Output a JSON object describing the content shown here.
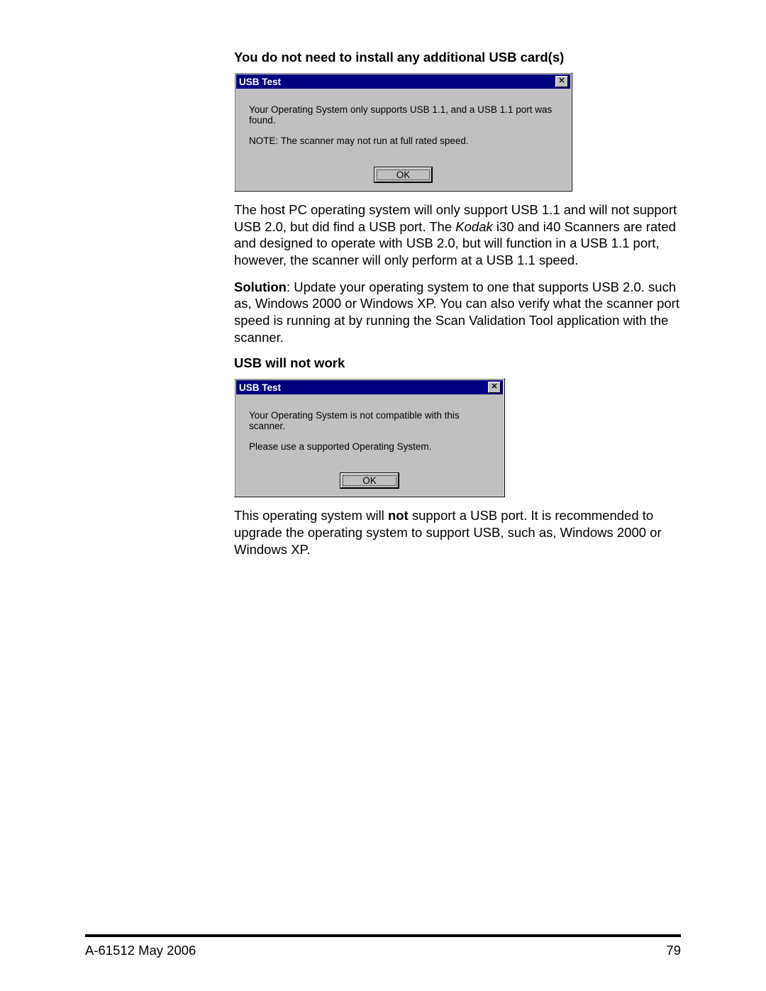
{
  "section1": {
    "heading": "You do not need to install any additional USB card(s)",
    "dialog": {
      "title": "USB Test",
      "line1": "Your Operating System only supports USB 1.1, and a USB 1.1 port was found.",
      "line2": "NOTE: The scanner may not run at full rated speed.",
      "ok": "OK"
    },
    "para1_a": "The host PC operating system will only support USB 1.1 and will not support USB 2.0, but did find a USB port. The ",
    "para1_italic": "Kodak",
    "para1_b": " i30 and i40 Scanners are rated and designed to operate with USB 2.0, but will function in a USB 1.1 port, however, the scanner will only perform at a USB 1.1 speed.",
    "para2_bold": "Solution",
    "para2_rest": ": Update your operating system to one that supports USB 2.0. such as, Windows 2000 or Windows XP. You can also verify what the scanner port speed is running at by running the Scan Validation Tool application with the scanner."
  },
  "section2": {
    "heading": "USB will not work",
    "dialog": {
      "title": "USB Test",
      "line1": "Your Operating System is not compatible with this scanner.",
      "line2": "Please use a supported Operating System.",
      "ok": "OK"
    },
    "para_a": "This operating system will ",
    "para_bold": "not",
    "para_b": " support a USB port. It is recommended to upgrade the operating system to support USB, such as, Windows 2000 or Windows XP."
  },
  "footer": {
    "left": "A-61512   May 2006",
    "right": "79"
  }
}
